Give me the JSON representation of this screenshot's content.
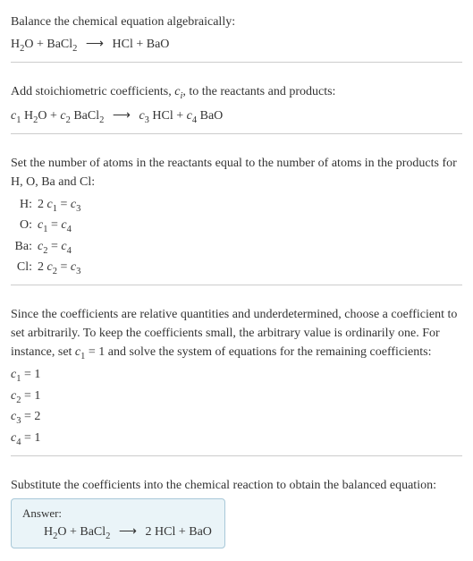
{
  "sections": {
    "intro": {
      "title": "Balance the chemical equation algebraically:",
      "equation_html": "H<sub>2</sub>O + BaCl<sub>2</sub> <span class='arrow'>⟶</span> HCl + BaO"
    },
    "stoich": {
      "text_html": "Add stoichiometric coefficients, <span class='italic'>c<span class='sub-i'>i</span></span>, to the reactants and products:",
      "equation_html": "<span class='italic'>c</span><sub>1</sub> H<sub>2</sub>O + <span class='italic'>c</span><sub>2</sub> BaCl<sub>2</sub> <span class='arrow'>⟶</span> <span class='italic'>c</span><sub>3</sub> HCl + <span class='italic'>c</span><sub>4</sub> BaO"
    },
    "atoms": {
      "text": "Set the number of atoms in the reactants equal to the number of atoms in the products for H, O, Ba and Cl:",
      "rows": [
        {
          "label": "H:",
          "eq_html": "2 <span class='italic'>c</span><sub>1</sub> = <span class='italic'>c</span><sub>3</sub>"
        },
        {
          "label": "O:",
          "eq_html": "<span class='italic'>c</span><sub>1</sub> = <span class='italic'>c</span><sub>4</sub>"
        },
        {
          "label": "Ba:",
          "eq_html": "<span class='italic'>c</span><sub>2</sub> = <span class='italic'>c</span><sub>4</sub>"
        },
        {
          "label": "Cl:",
          "eq_html": "2 <span class='italic'>c</span><sub>2</sub> = <span class='italic'>c</span><sub>3</sub>"
        }
      ]
    },
    "choose": {
      "text_html": "Since the coefficients are relative quantities and underdetermined, choose a coefficient to set arbitrarily. To keep the coefficients small, the arbitrary value is ordinarily one. For instance, set <span class='italic'>c</span><sub>1</sub> = 1 and solve the system of equations for the remaining coefficients:",
      "coeffs": [
        {
          "html": "<span class='italic'>c</span><sub>1</sub> = 1"
        },
        {
          "html": "<span class='italic'>c</span><sub>2</sub> = 1"
        },
        {
          "html": "<span class='italic'>c</span><sub>3</sub> = 2"
        },
        {
          "html": "<span class='italic'>c</span><sub>4</sub> = 1"
        }
      ]
    },
    "substitute": {
      "text": "Substitute the coefficients into the chemical reaction to obtain the balanced equation:"
    },
    "answer": {
      "label": "Answer:",
      "equation_html": "H<sub>2</sub>O + BaCl<sub>2</sub> <span class='arrow'>⟶</span> 2 HCl + BaO"
    }
  }
}
